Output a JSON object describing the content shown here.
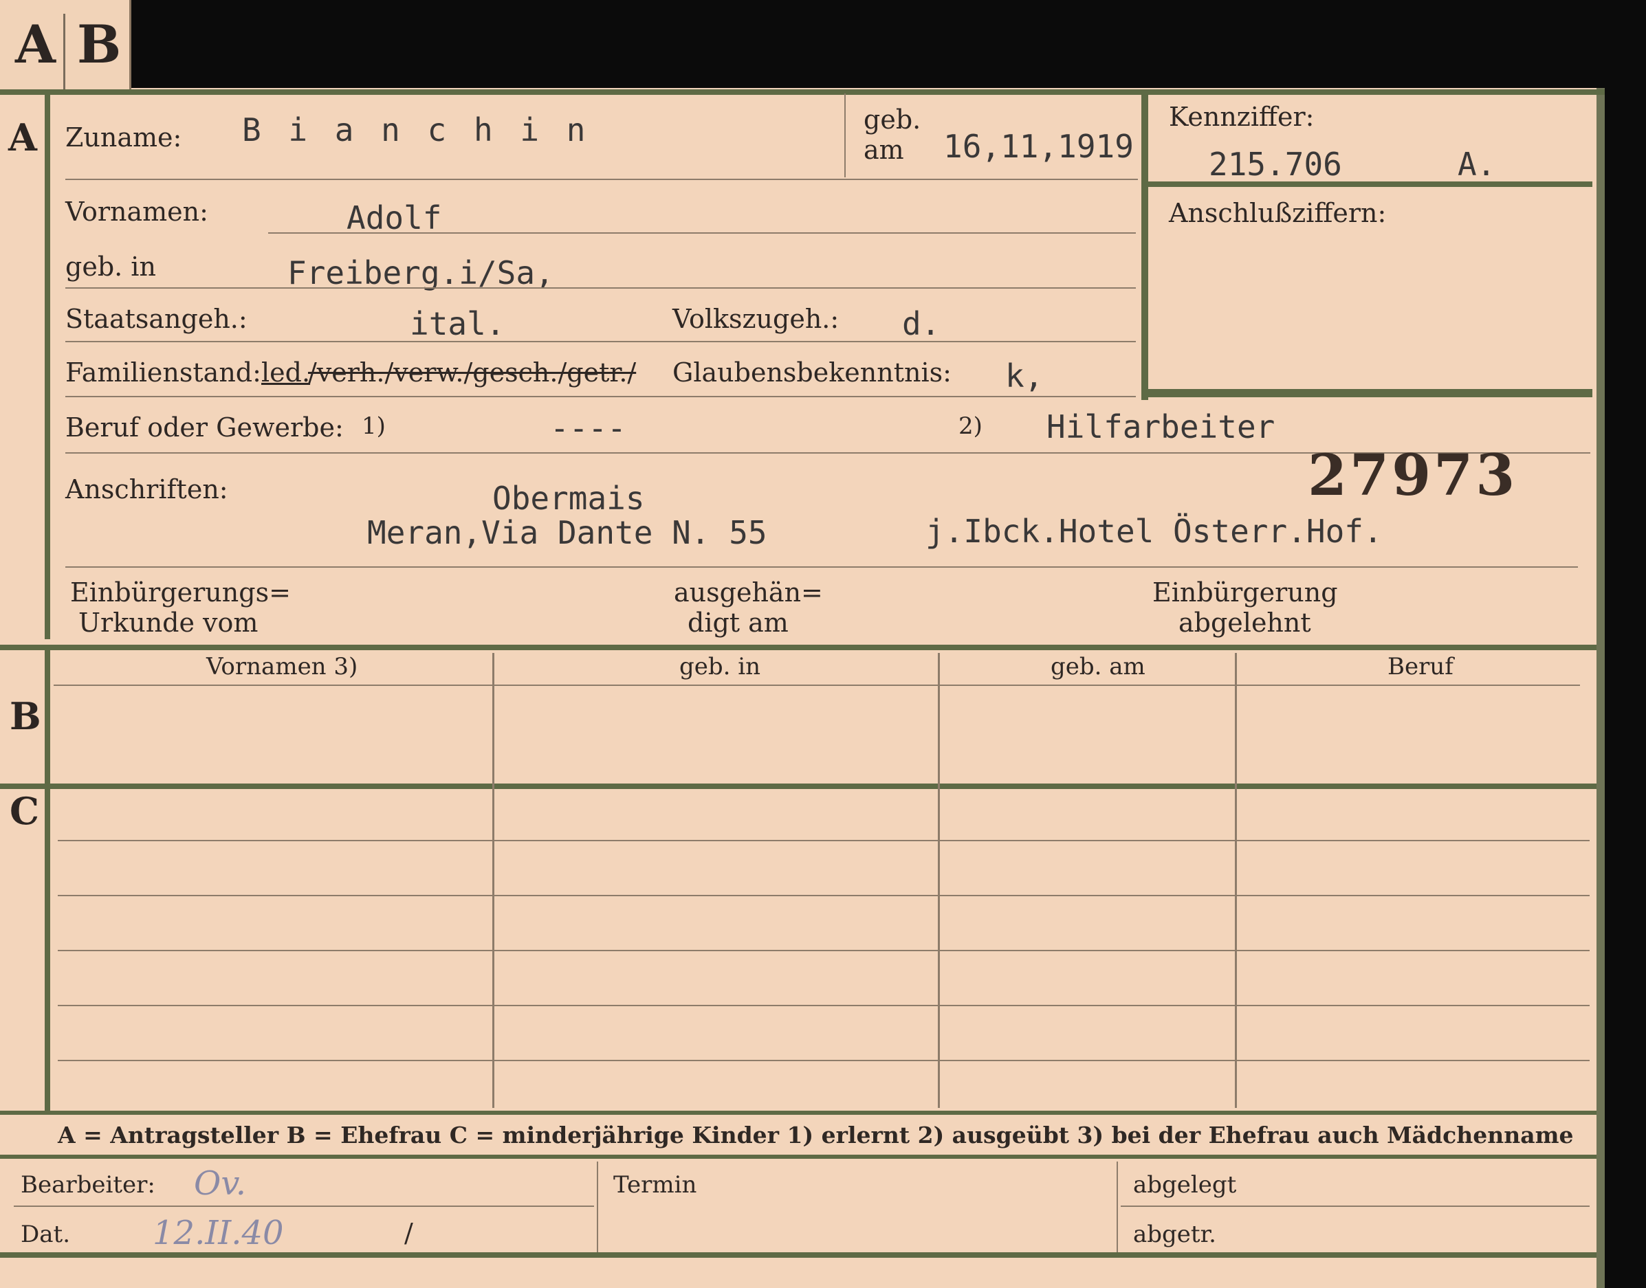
{
  "tab": {
    "letter_a": "A",
    "letter_b": "B"
  },
  "sections": {
    "a": "A",
    "b": "B",
    "c": "C"
  },
  "fields": {
    "zuname_label": "Zuname:",
    "zuname_value": "B i a n c h i n",
    "geb_label_1": "geb.",
    "geb_label_2": "am",
    "geb_am_value": "16,11,1919",
    "kennziffer_label": "Kennziffer:",
    "kennziffer_value": "215.706",
    "kennziffer_suffix": "A.",
    "anschlussziffern_label": "Anschlußziffern:",
    "vornamen_label": "Vornamen:",
    "vornamen_value": "Adolf",
    "geb_in_label": "geb. in",
    "geb_in_value": "Freiberg.i/Sa,",
    "staatsangeh_label": "Staatsangeh.:",
    "staatsangeh_value": "ital.",
    "volkszugeh_label": "Volkszugeh.:",
    "volkszugeh_value": "d.",
    "familienstand_label": "Familienstand:",
    "familienstand_led": "led.",
    "familienstand_rest": "/verh./verw./gesch./getr./",
    "glaubens_label": "Glaubensbekenntnis:",
    "glaubens_value": "k,",
    "beruf_label": "Beruf oder Gewerbe:",
    "beruf_note1": "1)",
    "beruf_value1": "----",
    "beruf_note2": "2)",
    "beruf_value2": "Hilfarbeiter",
    "anschriften_label": "Anschriften:",
    "stamp_number": "27973",
    "address_line1": "Obermais",
    "address_line2": "Meran,Via Dante N. 55",
    "address_line3": "j.Ibck.Hotel Österr.Hof.",
    "einbuergerung_urkunde_1": "Einbürgerungs=",
    "einbuergerung_urkunde_2": "Urkunde vom",
    "ausgehaendigt_1": "ausgehän=",
    "ausgehaendigt_2": "digt am",
    "einbuergerung_abgelehnt_1": "Einbürgerung",
    "einbuergerung_abgelehnt_2": "abgelehnt"
  },
  "table_b": {
    "headers": [
      "Vornamen 3)",
      "geb. in",
      "geb. am",
      "Beruf"
    ]
  },
  "legend": "A = Antragsteller   B = Ehefrau   C = minderjährige Kinder   1) erlernt   2) ausgeübt   3) bei der Ehefrau auch Mädchenname",
  "footer": {
    "bearbeiter_label": "Bearbeiter:",
    "bearbeiter_value": "Ov.",
    "termin_label": "Termin",
    "abgelegt_label": "abgelegt",
    "dat_label": "Dat.",
    "dat_value": "12.II.40",
    "dat_slash": "/",
    "abgetr_label": "abgetr."
  }
}
